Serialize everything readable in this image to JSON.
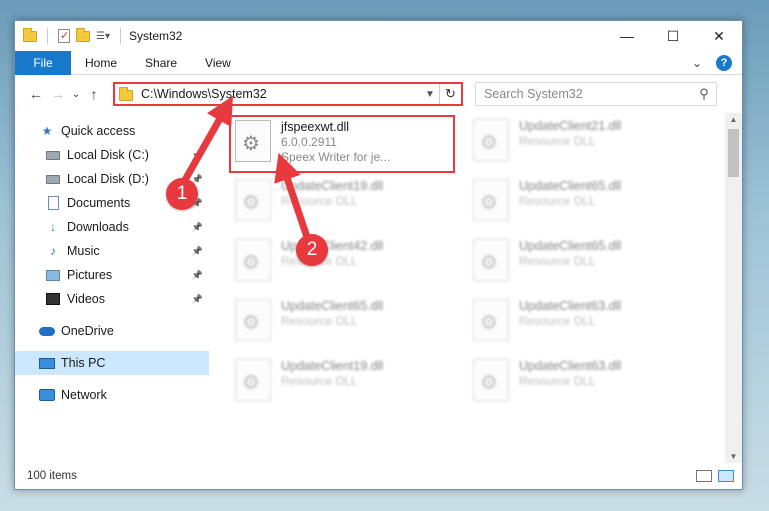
{
  "window": {
    "title": "System32",
    "controls": {
      "minimize": "—",
      "maximize": "☐",
      "close": "✕"
    }
  },
  "ribbon": {
    "tabs": [
      "File",
      "Home",
      "Share",
      "View"
    ],
    "expand": "⌄",
    "help": "?"
  },
  "nav": {
    "back": "←",
    "forward": "→",
    "recent": "⌄",
    "up": "↑",
    "address": "C:\\Windows\\System32",
    "search_placeholder": "Search System32"
  },
  "sidebar": {
    "items": [
      {
        "label": "Quick access",
        "icon": "star-icon",
        "pinned": false
      },
      {
        "label": "Local Disk (C:)",
        "icon": "drive-icon",
        "pinned": true
      },
      {
        "label": "Local Disk (D:)",
        "icon": "drive-icon",
        "pinned": true
      },
      {
        "label": "Documents",
        "icon": "document-icon",
        "pinned": true
      },
      {
        "label": "Downloads",
        "icon": "download-icon",
        "pinned": true
      },
      {
        "label": "Music",
        "icon": "music-icon",
        "pinned": true
      },
      {
        "label": "Pictures",
        "icon": "pictures-icon",
        "pinned": true
      },
      {
        "label": "Videos",
        "icon": "videos-icon",
        "pinned": true
      },
      {
        "label": "OneDrive",
        "icon": "onedrive-icon",
        "pinned": false
      },
      {
        "label": "This PC",
        "icon": "pc-icon",
        "pinned": false,
        "selected": true
      },
      {
        "label": "Network",
        "icon": "network-icon",
        "pinned": false
      }
    ]
  },
  "files": [
    {
      "name": "jfspeexwt.dll",
      "line2": "6.0.0.2911",
      "line3": "Speex Writer for je...",
      "highlighted": true
    },
    {
      "name": "UpdateClient21.dll",
      "line2": "Resource DLL"
    },
    {
      "name": "UpdateClient19.dll",
      "line2": "Resource DLL"
    },
    {
      "name": "UpdateClient65.dll",
      "line2": "Resource DLL"
    },
    {
      "name": "UpdateClient42.dll",
      "line2": "Resource DLL"
    },
    {
      "name": "UpdateClient65.dll",
      "line2": "Resource DLL"
    },
    {
      "name": "UpdateClient65.dll",
      "line2": "Resource DLL"
    },
    {
      "name": "UpdateClient63.dll",
      "line2": "Resource DLL"
    },
    {
      "name": "UpdateClient19.dll",
      "line2": "Resource DLL"
    },
    {
      "name": "UpdateClient63.dll",
      "line2": "Resource DLL"
    }
  ],
  "status": {
    "count": "100 items"
  },
  "annotations": {
    "step1": "1",
    "step2": "2",
    "color": "#e8393f"
  }
}
